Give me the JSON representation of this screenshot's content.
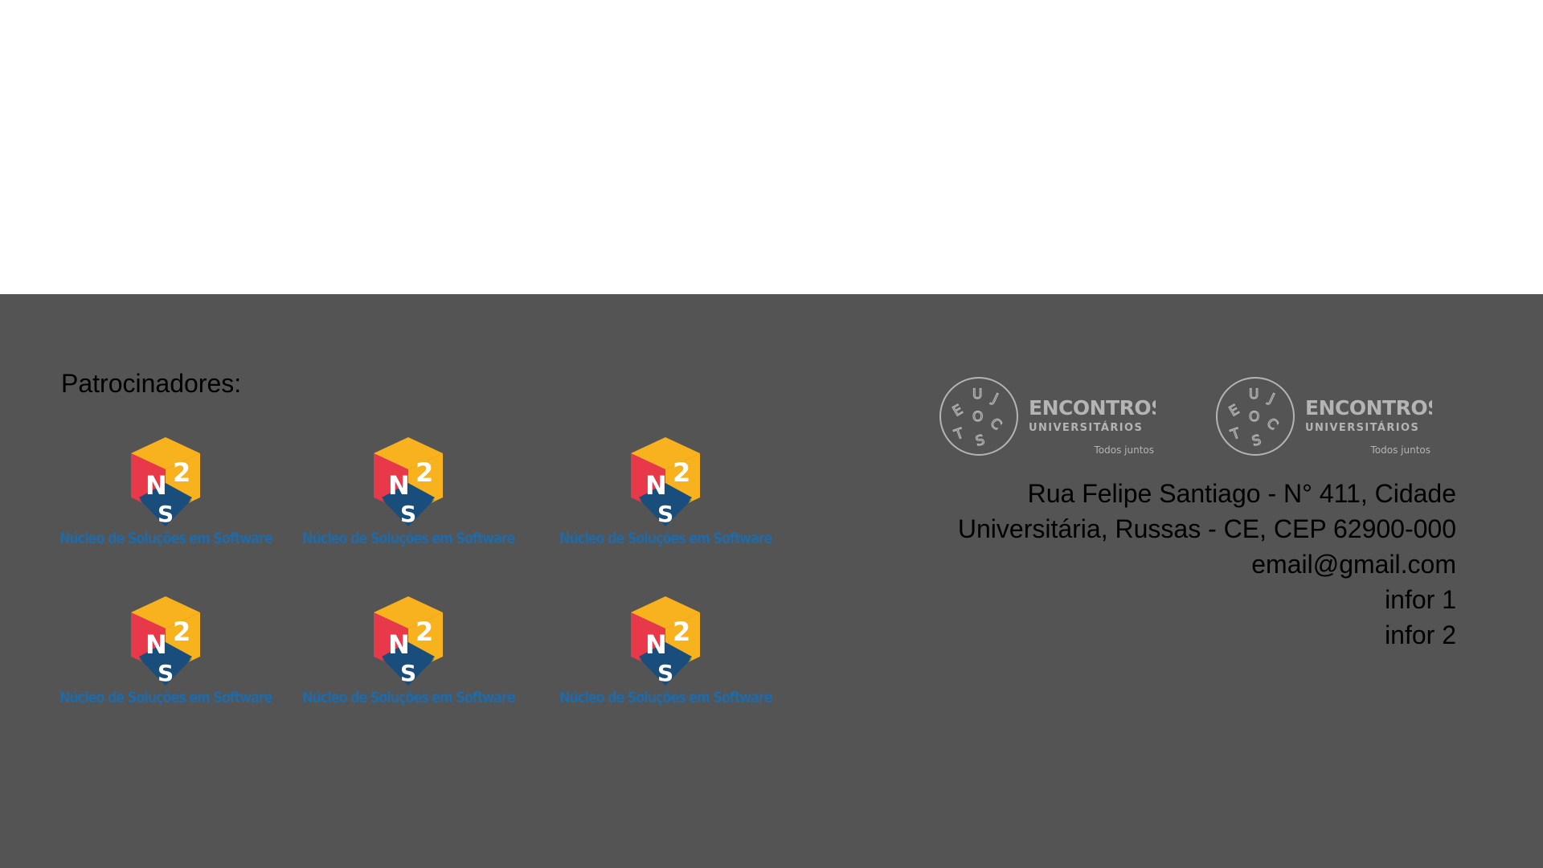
{
  "footer": {
    "sponsors_title": "Patrocinadores:",
    "sponsors": [
      {
        "name": "Núcleo de Soluções em Software",
        "logo": "n2s-cube-logo"
      },
      {
        "name": "Núcleo de Soluções em Software",
        "logo": "n2s-cube-logo"
      },
      {
        "name": "Núcleo de Soluções em Software",
        "logo": "n2s-cube-logo"
      },
      {
        "name": "Núcleo de Soluções em Software",
        "logo": "n2s-cube-logo"
      },
      {
        "name": "Núcleo de Soluções em Software",
        "logo": "n2s-cube-logo"
      },
      {
        "name": "Núcleo de Soluções em Software",
        "logo": "n2s-cube-logo"
      }
    ],
    "partners": [
      {
        "title": "ENCONTROS",
        "subtitle": "UNIVERSITÁRIOS",
        "tagline": "Todos juntos",
        "seal": "E U J C O S T"
      },
      {
        "title": "ENCONTROS",
        "subtitle": "UNIVERSITÁRIOS",
        "tagline": "Todos juntos",
        "seal": "E U J C O S T"
      }
    ],
    "contact": {
      "address_line1": "Rua Felipe Santiago - N° 411, Cidade",
      "address_line2": "Universitária, Russas - CE, CEP 62900-000",
      "email": "email@gmail.com",
      "info1": "infor 1",
      "info2": "infor 2"
    }
  },
  "colors": {
    "footer_background": "#545454",
    "top_background": "#ffffff",
    "sponsor_label": "#1f6aa8",
    "logo_red": "#e8394b",
    "logo_yellow": "#f8b21e",
    "logo_navy": "#184d7c",
    "partner_logo_gray": "#b4b4b4"
  }
}
